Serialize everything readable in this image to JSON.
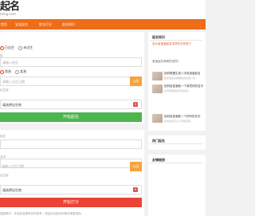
{
  "header": {
    "logo_text": "起名",
    "logo_sub": "ming.com"
  },
  "nav": {
    "items": [
      {
        "label": "首页"
      },
      {
        "label": "宝宝起名"
      },
      {
        "label": "姓名打分"
      },
      {
        "label": "起名知识"
      }
    ]
  },
  "form1": {
    "option_a": "已出生",
    "option_b": "未出生",
    "surname_label": "姓",
    "surname_placeholder": "请输入姓氏",
    "gender_male": "男孩",
    "gender_female": "女孩",
    "birth_label": "日期",
    "birth_placeholder": "请输入出生日期",
    "birth_addon": "公历",
    "birthplace_label": "出生地",
    "birthplace_value": "请选择出生地",
    "birthplace_addon": "×",
    "submit_label": "开始起名"
  },
  "form2": {
    "surname_label": "姓氏",
    "name_label": "名字",
    "birth_label": "日期",
    "birth_placeholder": "请输入出生日期",
    "birth_addon": "公历",
    "birthplace_label": "出生地",
    "birthplace_value": "请选择出生地",
    "birthplace_addon": "×",
    "submit_label": "开始打分"
  },
  "notice": "温馨提示：本站起名服务仅供参考，请结合自身实际情况慎重选择。",
  "sidebar": {
    "knowledge_title": "起名知识",
    "knowledge_links": [
      "怎么给宝宝起名字好听又有意义",
      "宝宝起名有哪些讲究？"
    ],
    "articles": [
      {
        "title": "如何根据生辰八字给宝宝起名",
        "desc": "给宝宝起名需要结合生辰八字..."
      },
      {
        "title": "如何给宝宝取一个寓意好的名字",
        "desc": "名字寓意的好坏关系到..."
      },
      {
        "title": "如何给宝宝取一个好听的名字",
        "desc": "好听的名字让人印象深刻..."
      }
    ],
    "hot_title": "热门起名",
    "friends_title": "友情链接"
  }
}
